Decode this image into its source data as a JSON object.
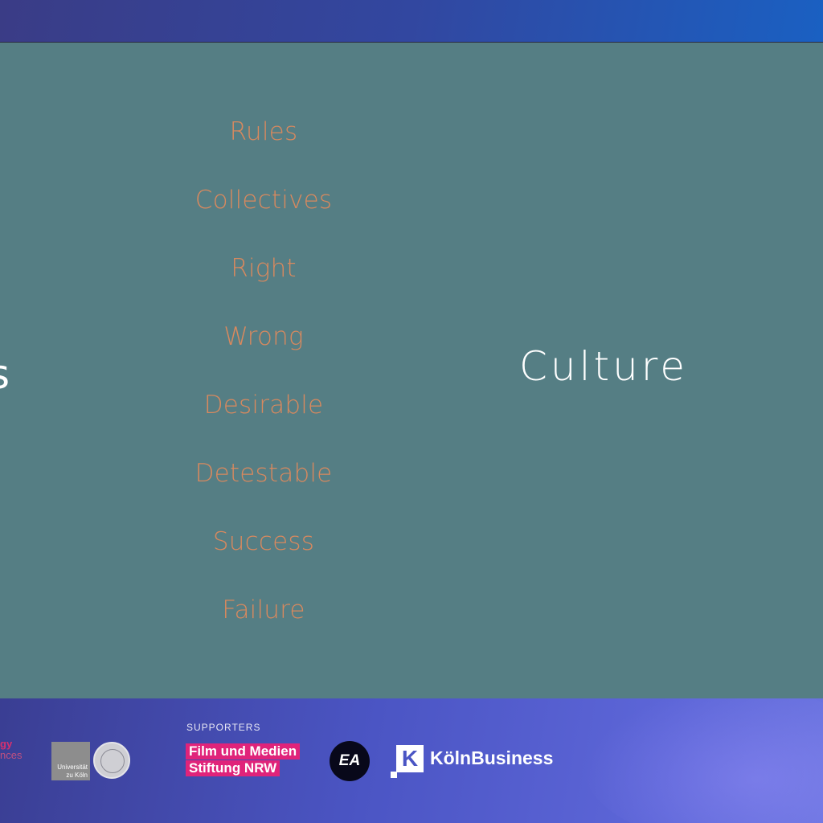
{
  "slide": {
    "words": [
      "Rules",
      "Collectives",
      "Right",
      "Wrong",
      "Desirable",
      "Detestable",
      "Success",
      "Failure"
    ],
    "main_word": "Culture",
    "edge_glyph": "s"
  },
  "footer": {
    "partner_line1": "gy",
    "partner_line2": "nces",
    "university_logo_text": "Universität zu Köln",
    "supporters_label": "SUPPORTERS",
    "film_logo_line1": "Film und Medien",
    "film_logo_line2": "Stiftung NRW",
    "ea_logo_text": "EA",
    "koeln_mark_letter": "K",
    "koeln_logo_text": "KölnBusiness"
  },
  "colors": {
    "slide_background": "#557e84",
    "word_color": "#d9895e",
    "main_word_color": "#ffffff",
    "film_logo_pink": "#e0237a"
  }
}
